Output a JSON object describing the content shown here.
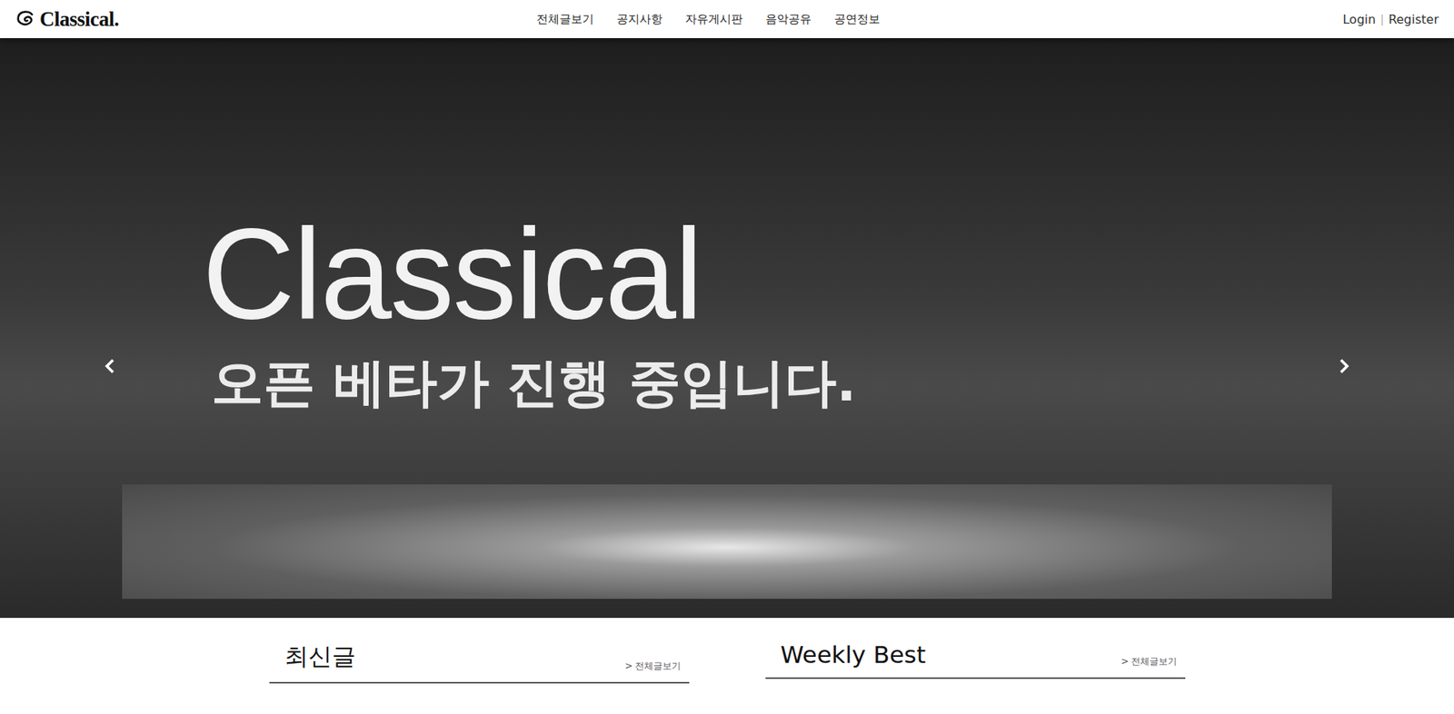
{
  "logo": {
    "text": "Classical."
  },
  "nav": {
    "items": [
      {
        "label": "전체글보기"
      },
      {
        "label": "공지사항"
      },
      {
        "label": "자유게시판"
      },
      {
        "label": "음악공유"
      },
      {
        "label": "공연정보"
      }
    ]
  },
  "auth": {
    "login": "Login",
    "separator": "|",
    "register": "Register"
  },
  "hero": {
    "title": "Classical",
    "subtitle": "오픈 베타가 진행 중입니다."
  },
  "sections": [
    {
      "title": "최신글",
      "more": "> 전체글보기"
    },
    {
      "title": "Weekly Best",
      "more": "> 전체글보기"
    }
  ]
}
